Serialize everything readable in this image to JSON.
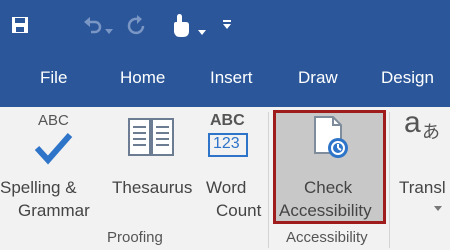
{
  "colors": {
    "titlebar": "#2b579a",
    "ribbon": "#f2f2f2",
    "highlight_border": "#9e1c1c",
    "accessibility_accent": "#2e74c9"
  },
  "tabs": [
    "File",
    "Home",
    "Insert",
    "Draw",
    "Design"
  ],
  "quick_access": [
    "save-icon",
    "undo-icon",
    "redo-icon",
    "touch-mode-icon",
    "customize-quick-access-icon"
  ],
  "ribbon": {
    "spelling": {
      "icon_text": "ABC",
      "label_line1": "Spelling &",
      "label_line2": "Grammar"
    },
    "thesaurus": {
      "label": "Thesaurus"
    },
    "word_count": {
      "icon_top": "ABC",
      "icon_bottom": "123",
      "label_line1": "Word",
      "label_line2": "Count"
    },
    "check_accessibility": {
      "label_line1": "Check",
      "label_line2": "Accessibility"
    },
    "translate": {
      "icon_text": "a",
      "icon_sub": "あ",
      "label": "Transl"
    },
    "groups": {
      "proofing": "Proofing",
      "accessibility": "Accessibility"
    }
  }
}
